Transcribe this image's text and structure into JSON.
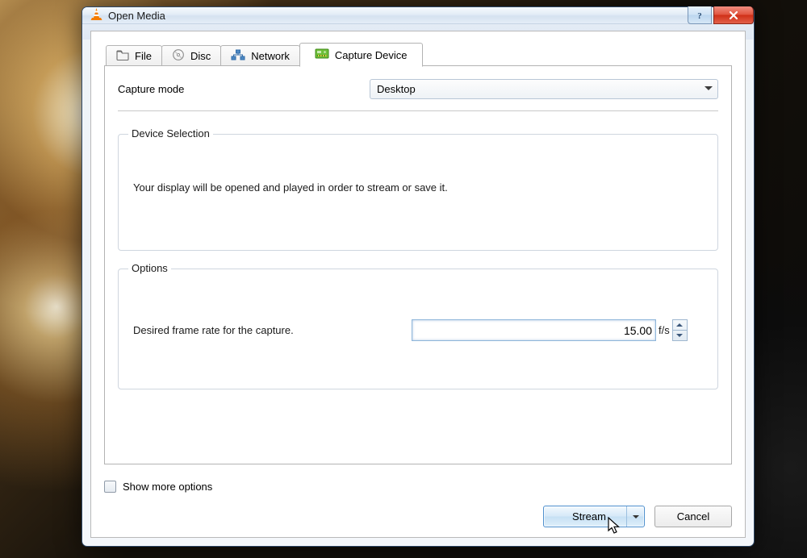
{
  "window": {
    "title": "Open Media"
  },
  "tabs": {
    "file": {
      "label": "File"
    },
    "disc": {
      "label": "Disc"
    },
    "network": {
      "label": "Network"
    },
    "capture": {
      "label": "Capture Device"
    }
  },
  "capture_mode": {
    "label": "Capture mode",
    "value": "Desktop"
  },
  "device_selection": {
    "legend": "Device Selection",
    "message": "Your display will be opened and played in order to stream or save it."
  },
  "options": {
    "legend": "Options",
    "fps_label": "Desired frame rate for the capture.",
    "fps_value": "15.00",
    "fps_unit": "f/s"
  },
  "footer": {
    "show_more": "Show more options",
    "stream": "Stream",
    "cancel": "Cancel"
  }
}
